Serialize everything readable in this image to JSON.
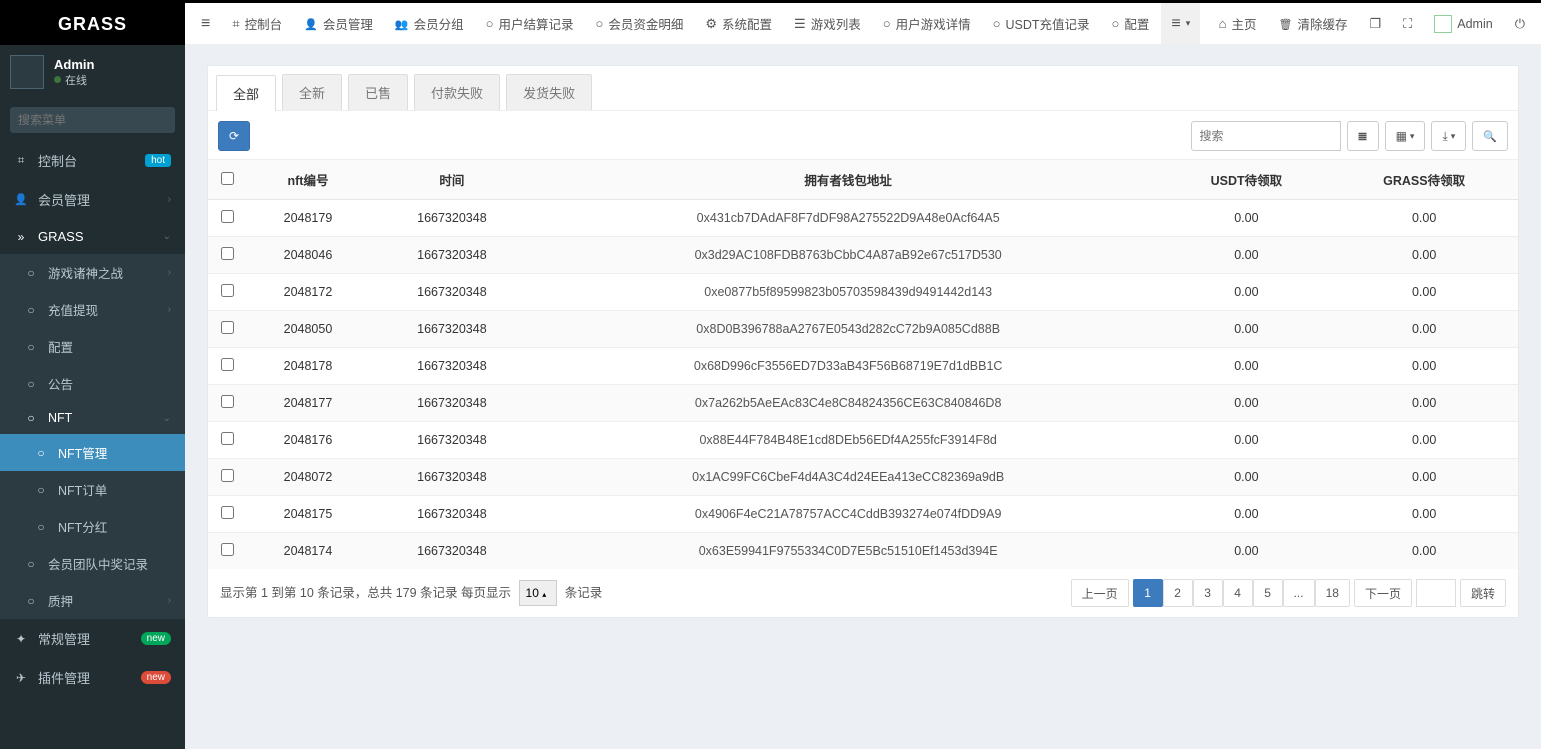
{
  "brand": "GRASS",
  "user": {
    "name": "Admin",
    "status": "在线"
  },
  "sidebar_search_placeholder": "搜索菜单",
  "sidebar": {
    "dashboard": "控制台",
    "dashboard_badge": "hot",
    "member_mgmt": "会员管理",
    "grass": "GRASS",
    "game_gods": "游戏诸神之战",
    "deposit_withdraw": "充值提现",
    "config": "配置",
    "announcement": "公告",
    "nft": "NFT",
    "nft_mgmt": "NFT管理",
    "nft_order": "NFT订单",
    "nft_dividend": "NFT分红",
    "team_winning": "会员团队中奖记录",
    "pledge": "质押",
    "general_mgmt": "常规管理",
    "general_badge": "new",
    "plugin_mgmt": "插件管理",
    "plugin_badge": "new"
  },
  "topnav": {
    "dashboard": "控制台",
    "member_mgmt": "会员管理",
    "member_group": "会员分组",
    "user_settle": "用户结算记录",
    "member_fund": "会员资金明细",
    "sys_config": "系统配置",
    "game_list": "游戏列表",
    "user_game_detail": "用户游戏详情",
    "usdt_recharge": "USDT充值记录",
    "config": "配置",
    "home": "主页",
    "clear_cache": "清除缓存",
    "admin": "Admin"
  },
  "tabs": {
    "all": "全部",
    "brand_new": "全新",
    "sold": "已售",
    "pay_fail": "付款失败",
    "ship_fail": "发货失败"
  },
  "search_placeholder": "搜索",
  "columns": {
    "nft_id": "nft编号",
    "time": "时间",
    "owner_addr": "拥有者钱包地址",
    "usdt_pending": "USDT待领取",
    "grass_pending": "GRASS待领取"
  },
  "rows": [
    {
      "id": "2048179",
      "time": "1667320348",
      "addr": "0x431cb7DAdAF8F7dDF98A275522D9A48e0Acf64A5",
      "usdt": "0.00",
      "grass": "0.00"
    },
    {
      "id": "2048046",
      "time": "1667320348",
      "addr": "0x3d29AC108FDB8763bCbbC4A87aB92e67c517D530",
      "usdt": "0.00",
      "grass": "0.00"
    },
    {
      "id": "2048172",
      "time": "1667320348",
      "addr": "0xe0877b5f89599823b05703598439d9491442d143",
      "usdt": "0.00",
      "grass": "0.00"
    },
    {
      "id": "2048050",
      "time": "1667320348",
      "addr": "0x8D0B396788aA2767E0543d282cC72b9A085Cd88B",
      "usdt": "0.00",
      "grass": "0.00"
    },
    {
      "id": "2048178",
      "time": "1667320348",
      "addr": "0x68D996cF3556ED7D33aB43F56B68719E7d1dBB1C",
      "usdt": "0.00",
      "grass": "0.00"
    },
    {
      "id": "2048177",
      "time": "1667320348",
      "addr": "0x7a262b5AeEAc83C4e8C84824356CE63C840846D8",
      "usdt": "0.00",
      "grass": "0.00"
    },
    {
      "id": "2048176",
      "time": "1667320348",
      "addr": "0x88E44F784B48E1cd8DEb56EDf4A255fcF3914F8d",
      "usdt": "0.00",
      "grass": "0.00"
    },
    {
      "id": "2048072",
      "time": "1667320348",
      "addr": "0x1AC99FC6CbeF4d4A3C4d24EEa413eCC82369a9dB",
      "usdt": "0.00",
      "grass": "0.00"
    },
    {
      "id": "2048175",
      "time": "1667320348",
      "addr": "0x4906F4eC21A78757ACC4CddB393274e074fDD9A9",
      "usdt": "0.00",
      "grass": "0.00"
    },
    {
      "id": "2048174",
      "time": "1667320348",
      "addr": "0x63E59941F9755334C0D7E5Bc51510Ef1453d394E",
      "usdt": "0.00",
      "grass": "0.00"
    }
  ],
  "footer": {
    "summary_prefix": "显示第 1 到第 10 条记录，总共 179 条记录 每页显示",
    "page_size": "10",
    "summary_suffix": "条记录",
    "prev": "上一页",
    "next": "下一页",
    "pages": [
      "1",
      "2",
      "3",
      "4",
      "5",
      "...",
      "18"
    ],
    "jump": "跳转"
  }
}
